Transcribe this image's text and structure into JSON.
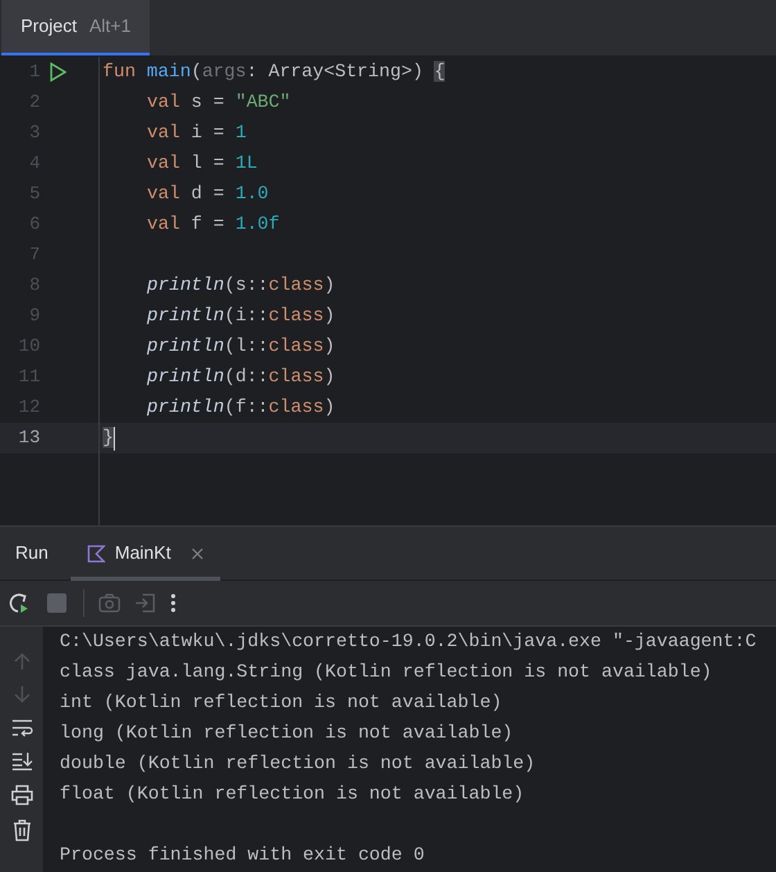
{
  "top_tab": {
    "label": "Project",
    "shortcut": "Alt+1",
    "selected": true
  },
  "editor": {
    "lines": [
      {
        "number": "1",
        "run": true,
        "tokens": [
          {
            "kind": "keyword",
            "text": "fun "
          },
          {
            "kind": "function",
            "text": "main"
          },
          {
            "kind": "plain",
            "text": "("
          },
          {
            "kind": "param",
            "text": "args"
          },
          {
            "kind": "plain",
            "text": ": Array<String>) "
          },
          {
            "kind": "brace",
            "text": "{"
          }
        ]
      },
      {
        "number": "2",
        "indented": true,
        "tokens": [
          {
            "kind": "keyword",
            "text": "val "
          },
          {
            "kind": "plain",
            "text": "s = "
          },
          {
            "kind": "string",
            "text": "\"ABC\""
          }
        ]
      },
      {
        "number": "3",
        "indented": true,
        "tokens": [
          {
            "kind": "keyword",
            "text": "val "
          },
          {
            "kind": "plain",
            "text": "i = "
          },
          {
            "kind": "number",
            "text": "1"
          }
        ]
      },
      {
        "number": "4",
        "indented": true,
        "tokens": [
          {
            "kind": "keyword",
            "text": "val "
          },
          {
            "kind": "plain",
            "text": "l = "
          },
          {
            "kind": "number",
            "text": "1L"
          }
        ]
      },
      {
        "number": "5",
        "indented": true,
        "tokens": [
          {
            "kind": "keyword",
            "text": "val "
          },
          {
            "kind": "plain",
            "text": "d = "
          },
          {
            "kind": "number",
            "text": "1.0"
          }
        ]
      },
      {
        "number": "6",
        "indented": true,
        "tokens": [
          {
            "kind": "keyword",
            "text": "val "
          },
          {
            "kind": "plain",
            "text": "f = "
          },
          {
            "kind": "number",
            "text": "1.0f"
          }
        ]
      },
      {
        "number": "7"
      },
      {
        "number": "8",
        "indented": true,
        "tokens": [
          {
            "kind": "call",
            "text": "println"
          },
          {
            "kind": "plain",
            "text": "(s::"
          },
          {
            "kind": "keyword",
            "text": "class"
          },
          {
            "kind": "plain",
            "text": ")"
          }
        ]
      },
      {
        "number": "9",
        "indented": true,
        "tokens": [
          {
            "kind": "call",
            "text": "println"
          },
          {
            "kind": "plain",
            "text": "(i::"
          },
          {
            "kind": "keyword",
            "text": "class"
          },
          {
            "kind": "plain",
            "text": ")"
          }
        ]
      },
      {
        "number": "10",
        "indented": true,
        "tokens": [
          {
            "kind": "call",
            "text": "println"
          },
          {
            "kind": "plain",
            "text": "(l::"
          },
          {
            "kind": "keyword",
            "text": "class"
          },
          {
            "kind": "plain",
            "text": ")"
          }
        ]
      },
      {
        "number": "11",
        "indented": true,
        "tokens": [
          {
            "kind": "call",
            "text": "println"
          },
          {
            "kind": "plain",
            "text": "(d::"
          },
          {
            "kind": "keyword",
            "text": "class"
          },
          {
            "kind": "plain",
            "text": ")"
          }
        ]
      },
      {
        "number": "12",
        "indented": true,
        "tokens": [
          {
            "kind": "call",
            "text": "println"
          },
          {
            "kind": "plain",
            "text": "(f::"
          },
          {
            "kind": "keyword",
            "text": "class"
          },
          {
            "kind": "plain",
            "text": ")"
          }
        ]
      },
      {
        "number": "13",
        "current": true,
        "tokens": [
          {
            "kind": "brace",
            "text": "}"
          }
        ]
      }
    ]
  },
  "run_panel": {
    "title": "Run",
    "tabs": [
      {
        "label": "MainKt",
        "selected": true
      }
    ],
    "console": [
      {
        "text": "C:\\Users\\atwku\\.jdks\\corretto-19.0.2\\bin\\java.exe \"-javaagent:C"
      },
      {
        "text": "class java.lang.String (Kotlin reflection is not available)"
      },
      {
        "text": "int (Kotlin reflection is not available)"
      },
      {
        "text": "long (Kotlin reflection is not available)"
      },
      {
        "text": "double (Kotlin reflection is not available)"
      },
      {
        "text": "float (Kotlin reflection is not available)"
      },
      {
        "text": "Process finished with exit code 0",
        "gap_before": true
      }
    ]
  }
}
